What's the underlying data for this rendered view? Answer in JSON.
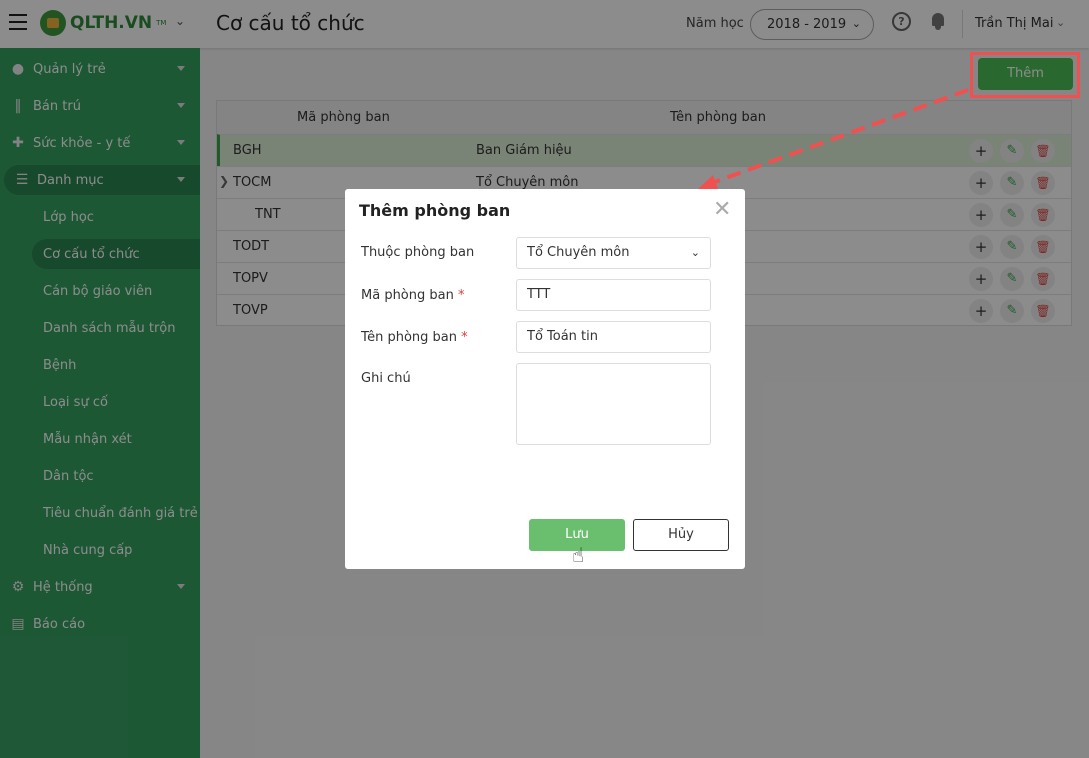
{
  "header": {
    "title": "Cơ cấu tổ chức",
    "logo": "QLTH.VN",
    "logo_tm": "TM",
    "year_label": "Năm học",
    "year_value": "2018 - 2019",
    "user": "Trần Thị Mai"
  },
  "sidebar": {
    "items": [
      {
        "label": "Quản lý trẻ",
        "icon": "users-icon"
      },
      {
        "label": "Bán trú",
        "icon": "utensils-icon"
      },
      {
        "label": "Sức khỏe - y tế",
        "icon": "medkit-icon"
      },
      {
        "label": "Danh mục",
        "icon": "list-icon"
      }
    ],
    "sub_items": [
      "Lớp học",
      "Cơ cấu tổ chức",
      "Cán bộ giáo viên",
      "Danh sách mẫu trộn",
      "Bệnh",
      "Loại sự cố",
      "Mẫu nhận xét",
      "Dân tộc",
      "Tiêu chuẩn đánh giá trẻ",
      "Nhà cung cấp"
    ],
    "bottom_items": [
      {
        "label": "Hệ thống",
        "icon": "gear-icon"
      },
      {
        "label": "Báo cáo",
        "icon": "report-icon"
      }
    ]
  },
  "toolbar": {
    "add_label": "Thêm"
  },
  "table": {
    "headers": [
      "Mã phòng ban",
      "Tên phòng ban"
    ],
    "rows": [
      {
        "code": "BGH",
        "name": "Ban Giám hiệu"
      },
      {
        "code": "TOCM",
        "name": "Tổ Chuyên môn"
      },
      {
        "code": "TNT",
        "name": ""
      },
      {
        "code": "TODT",
        "name": ""
      },
      {
        "code": "TOPV",
        "name": ""
      },
      {
        "code": "TOVP",
        "name": ""
      }
    ]
  },
  "modal": {
    "title": "Thêm phòng ban",
    "parent_label": "Thuộc phòng ban",
    "parent_value": "Tổ Chuyên môn",
    "code_label": "Mã phòng ban",
    "code_value": "TTT",
    "name_label": "Tên phòng ban",
    "name_value": "Tổ Toán tin",
    "note_label": "Ghi chú",
    "note_value": "",
    "required_mark": "*",
    "save_label": "Lưu",
    "cancel_label": "Hủy"
  },
  "colors": {
    "brand": "#36a062",
    "save": "#6abf6f",
    "annotation": "#f05050"
  }
}
